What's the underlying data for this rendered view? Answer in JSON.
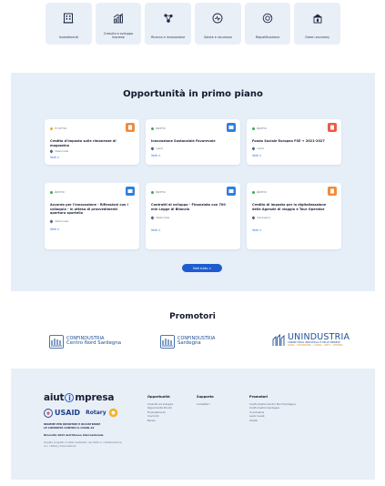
{
  "categories": [
    {
      "label": "Investimenti",
      "icon": "building-icon"
    },
    {
      "label": "Crescita e sviluppo imprese",
      "icon": "growth-icon"
    },
    {
      "label": "Ricerca e innovazione",
      "icon": "molecule-icon"
    },
    {
      "label": "Salute e sicurezza",
      "icon": "health-icon"
    },
    {
      "label": "Riqualificazione",
      "icon": "recycle-icon"
    },
    {
      "label": "Green economy",
      "icon": "green-building-icon"
    }
  ],
  "opportunities": {
    "title": "Opportunità in primo piano",
    "cards": [
      {
        "status": "In arrivo",
        "title": "Credito d'imposta sulle rimanenze di magazzino",
        "location": "Nazionale",
        "link": "Vedi >",
        "icon_color": "#f28b3c"
      },
      {
        "status": "Aperto",
        "title": "Innovazione Sostanziale Favorevole",
        "location": "Lazio",
        "link": "Vedi >",
        "icon_color": "#2f7fe0"
      },
      {
        "status": "Aperto",
        "title": "Fondo Sociale Europeo FSE + 2021-2027",
        "location": "Lazio",
        "link": "Vedi >",
        "icon_color": "#ef5a44"
      },
      {
        "status": "Aperto",
        "title": "Accordo per l'innovazione - Riflessioni con i colloquio - in attesa di provvedimenti apertura sportello",
        "location": "Nazionale",
        "link": "Vedi >",
        "icon_color": "#2f7fe0"
      },
      {
        "status": "Aperto",
        "title": "Contratti di sviluppo - Finanziato con 700 mln Legge di Bilancio",
        "location": "Nazionale",
        "link": "Vedi >",
        "icon_color": "#2f7fe0"
      },
      {
        "status": "Aperto",
        "title": "Credito di imposta per la digitalizzazione delle Agenzie di viaggio e Tour Operator",
        "location": "Sardegna",
        "link": "Vedi >",
        "icon_color": "#f28b3c"
      }
    ],
    "button_label": "Vedi tutto >"
  },
  "promoters": {
    "title": "Promotori",
    "logos": [
      {
        "line1": "CONFINDUSTRIA",
        "line2": "Centro Nord Sardegna"
      },
      {
        "line1": "CONFINDUSTRIA",
        "line2": "Sardegna"
      },
      {
        "line1": "UNINDUSTRIA",
        "line2": "UNIONE DEGLI INDUSTRIALI E DELLE IMPRESE",
        "line3": "ROMA • FROSINONE • LATINA • RIETI • VITERBO"
      }
    ]
  },
  "footer": {
    "logo_left": "aiut",
    "logo_i": "i",
    "logo_right": "mpresa",
    "sponsor_usaid": "USAID",
    "sponsor_rotary": "Rotary",
    "tagline": "INSIEME PER RIPARTIRE E RICOSTRUIRE LE COMUNITÀ CONTRO IL COVID-19",
    "partner": "Diversità 2024 dell'Ateneo Internazionale",
    "note": "Questo progetto è stato realizzato nel 2020 in collaborazione con i Rotary International",
    "columns": [
      {
        "heading": "Opportunità",
        "items": [
          "Crescita ed sviluppo",
          "Opportunità Privati",
          "Finanziamenti",
          "Covid-19",
          "Bando"
        ]
      },
      {
        "heading": "Supporto",
        "items": [
          "Contattaci"
        ]
      },
      {
        "heading": "Promotori",
        "items": [
          "Confindustria Centro Nord Sardegna",
          "Confindustria Sardegna",
          "Unindustria",
          "Lazio Invest",
          "USAID"
        ]
      }
    ]
  }
}
